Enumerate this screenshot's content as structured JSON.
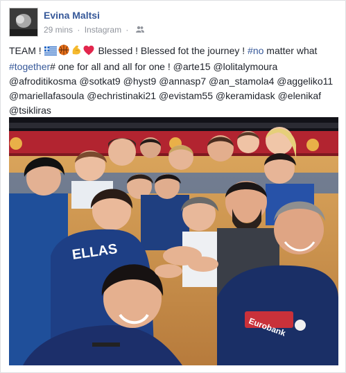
{
  "post": {
    "author": "Evina Maltsi",
    "time": "29 mins",
    "separator": "·",
    "source": "Instagram",
    "text": {
      "t1": "TEAM !",
      "t2": "Blessed ! Blessed fot the journey !",
      "tag_no": "#no",
      "t3": "matter what",
      "tag_together": "#together",
      "t4": "# one for all and all for one !",
      "m1": "@arte15",
      "m2": "@lolitalymoura",
      "m3": "@afroditikosma",
      "m4": "@sotkat9",
      "m5": "@hyst9",
      "m6": "@annasp7",
      "m7": "@an_stamola4",
      "m8": "@aggeliko11",
      "m9": "@mariellafasoula",
      "m10": "@echristinaki21",
      "m11": "@evistam55",
      "m12": "@keramidask",
      "m13": "@elenikaf",
      "m14": "@tsikliras"
    },
    "emojis": [
      "greece-flag",
      "basketball",
      "flexed-biceps",
      "red-heart"
    ],
    "audience_icon": "friends-icon",
    "photo": {
      "jersey_text": "ELLAS",
      "shirt_brand": "Eurobank"
    }
  },
  "colors": {
    "link": "#365899",
    "meta": "#90949c",
    "text": "#1d2129",
    "court_banner": "#b22430"
  }
}
